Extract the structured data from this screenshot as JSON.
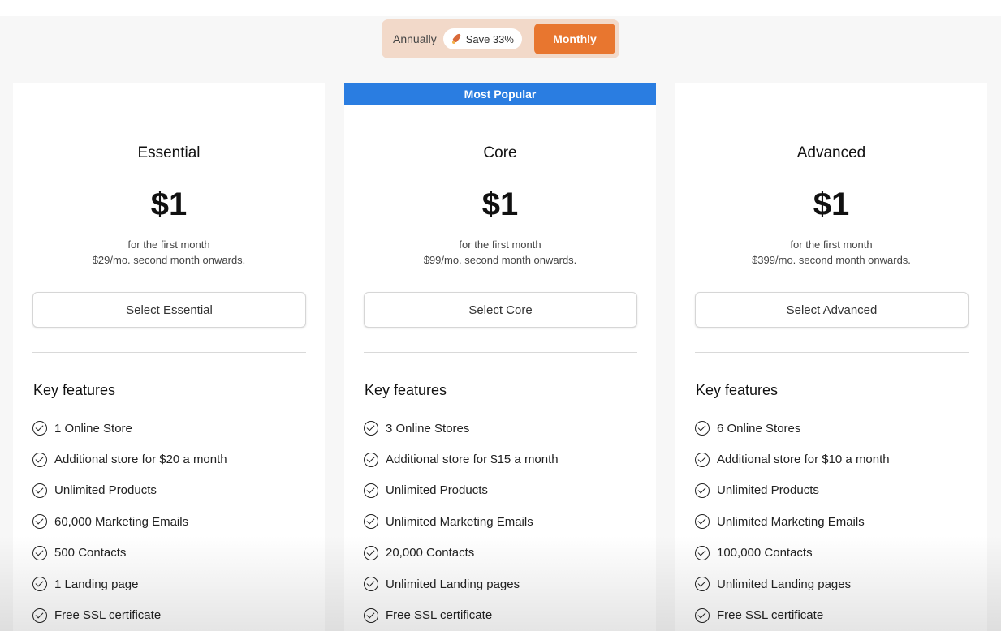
{
  "billing_toggle": {
    "annually_label": "Annually",
    "save_badge": "Save 33%",
    "monthly_label": "Monthly"
  },
  "section": {
    "features_title": "Key features"
  },
  "plans": [
    {
      "name": "Essential",
      "price": "$1",
      "price_note": "for the first month",
      "renewal_note": "$29/mo. second month onwards.",
      "button_label": "Select Essential",
      "features": [
        "1 Online Store",
        "Additional store for $20 a month",
        "Unlimited Products",
        "60,000 Marketing Emails",
        "500 Contacts",
        "1 Landing page",
        "Free SSL certificate"
      ]
    },
    {
      "badge": "Most Popular",
      "name": "Core",
      "price": "$1",
      "price_note": "for the first month",
      "renewal_note": "$99/mo. second month onwards.",
      "button_label": "Select Core",
      "features": [
        "3 Online Stores",
        "Additional store for $15 a month",
        "Unlimited Products",
        "Unlimited Marketing Emails",
        "20,000 Contacts",
        "Unlimited Landing pages",
        "Free SSL certificate"
      ]
    },
    {
      "name": "Advanced",
      "price": "$1",
      "price_note": "for the first month",
      "renewal_note": "$399/mo. second month onwards.",
      "button_label": "Select Advanced",
      "features": [
        "6 Online Stores",
        "Additional store for $10 a month",
        "Unlimited Products",
        "Unlimited Marketing Emails",
        "100,000 Contacts",
        "Unlimited Landing pages",
        "Free SSL certificate"
      ]
    }
  ],
  "colors": {
    "accent": "#e8762f",
    "toggle_bg": "#f2d9c9",
    "popular_badge": "#2a7de1"
  }
}
